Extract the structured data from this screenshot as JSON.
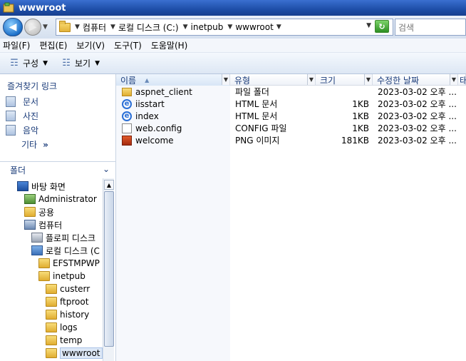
{
  "window": {
    "title": "wwwroot"
  },
  "address": {
    "crumbs": [
      "컴퓨터",
      "로컬 디스크 (C:)",
      "inetpub",
      "wwwroot"
    ],
    "search_placeholder": "검색"
  },
  "menu": [
    "파일(F)",
    "편집(E)",
    "보기(V)",
    "도구(T)",
    "도움말(H)"
  ],
  "toolbar": {
    "organize": "구성",
    "views": "보기"
  },
  "favorites": {
    "title": "즐겨찾기 링크",
    "items": [
      "문서",
      "사진",
      "음악"
    ],
    "more": "기타",
    "more_chevron": "»"
  },
  "folders": {
    "title": "폴더",
    "tree": [
      {
        "label": "바탕 화면",
        "icon": "desktop-icon"
      },
      {
        "label": "Administrator",
        "icon": "user-folder-icon"
      },
      {
        "label": "공용",
        "icon": "folder-icon"
      },
      {
        "label": "컴퓨터",
        "icon": "computer-icon"
      },
      {
        "label": "플로피 디스크",
        "icon": "floppy-drive-icon"
      },
      {
        "label": "로컬 디스크 (C",
        "icon": "local-disk-icon"
      },
      {
        "label": "EFSTMPWP",
        "icon": "folder-icon"
      },
      {
        "label": "inetpub",
        "icon": "folder-icon"
      },
      {
        "label": "custerr",
        "icon": "folder-icon"
      },
      {
        "label": "ftproot",
        "icon": "folder-icon"
      },
      {
        "label": "history",
        "icon": "folder-icon"
      },
      {
        "label": "logs",
        "icon": "folder-icon"
      },
      {
        "label": "temp",
        "icon": "folder-icon"
      },
      {
        "label": "wwwroot",
        "icon": "folder-icon"
      }
    ]
  },
  "columns": {
    "name": "이름",
    "type": "유형",
    "size": "크기",
    "date": "수정한 날짜",
    "extra": "태"
  },
  "files": [
    {
      "name": "aspnet_client",
      "type": "파일 폴더",
      "size": "",
      "date": "2023-03-02 오후 ...",
      "icon": "folder-icon"
    },
    {
      "name": "iisstart",
      "type": "HTML 문서",
      "size": "1KB",
      "date": "2023-03-02 오후 ...",
      "icon": "ie-document-icon"
    },
    {
      "name": "index",
      "type": "HTML 문서",
      "size": "1KB",
      "date": "2023-03-02 오후 ...",
      "icon": "ie-document-icon"
    },
    {
      "name": "web.config",
      "type": "CONFIG 파일",
      "size": "1KB",
      "date": "2023-03-02 오후 ...",
      "icon": "file-icon"
    },
    {
      "name": "welcome",
      "type": "PNG 이미지",
      "size": "181KB",
      "date": "2023-03-02 오후 ...",
      "icon": "png-image-icon"
    }
  ]
}
